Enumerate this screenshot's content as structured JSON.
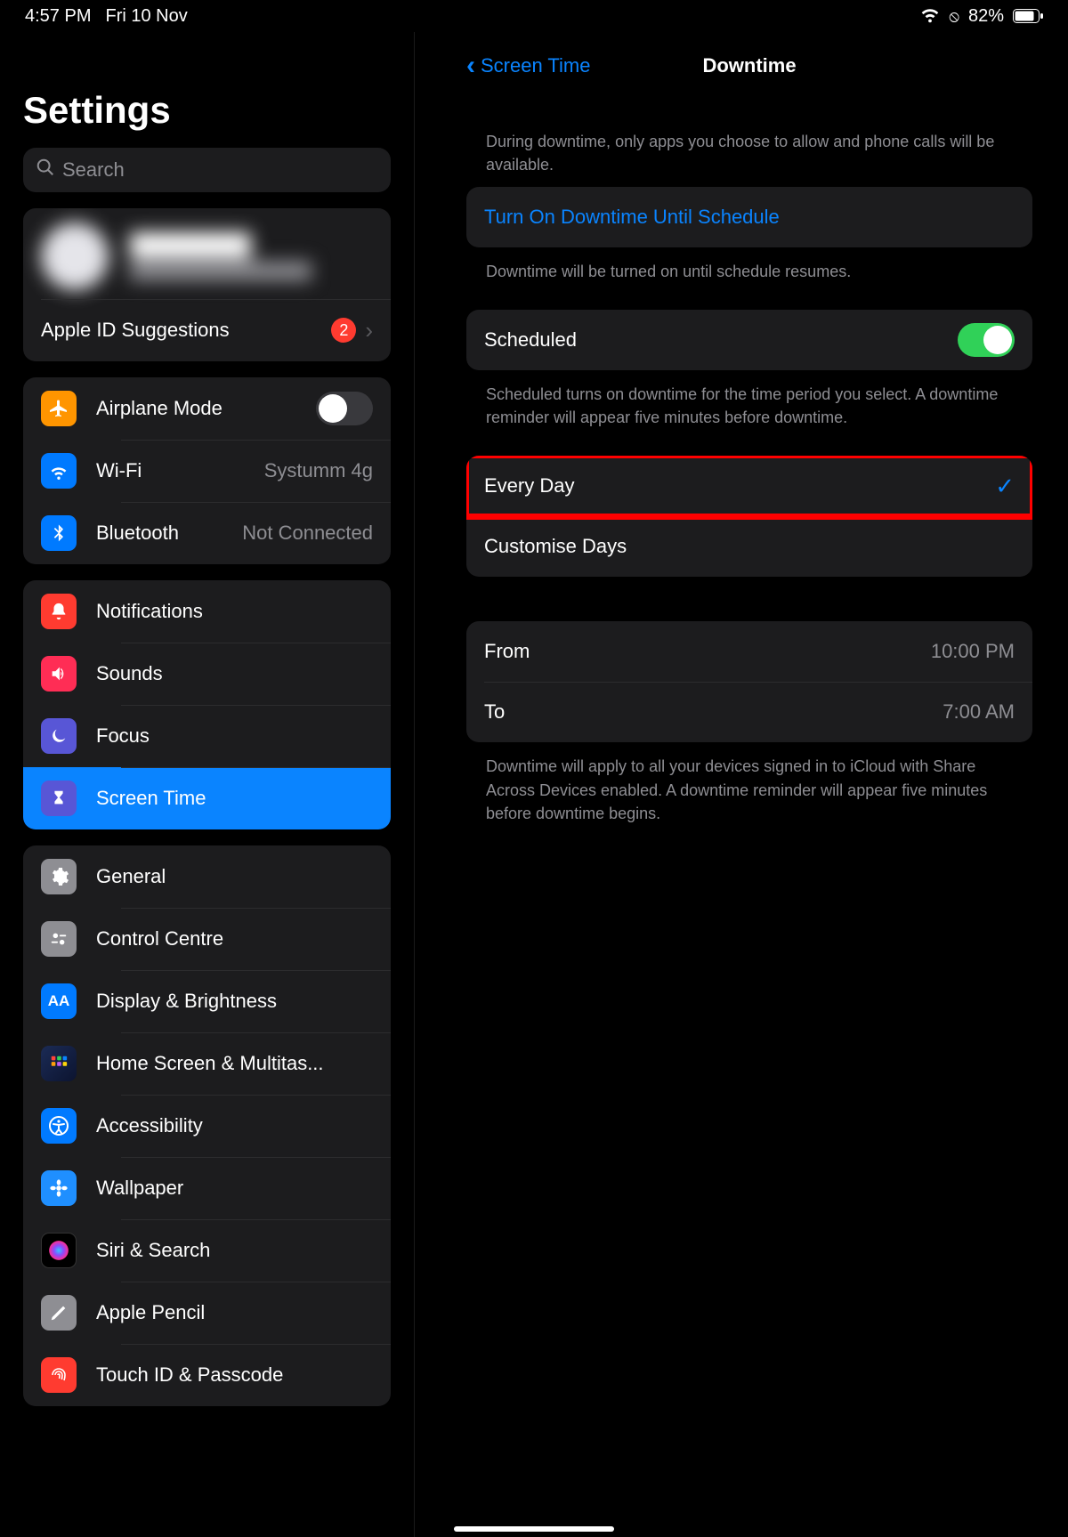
{
  "status": {
    "time": "4:57 PM",
    "date": "Fri 10 Nov",
    "battery_pct": "82%"
  },
  "left": {
    "title": "Settings",
    "search_placeholder": "Search",
    "apple_id": {
      "suggestions_label": "Apple ID Suggestions",
      "suggestions_count": "2"
    },
    "groups": [
      {
        "items": [
          {
            "label": "Airplane Mode",
            "right_type": "toggle_off",
            "icon_bg": "bg-orange",
            "icon": "airplane"
          },
          {
            "label": "Wi-Fi",
            "detail": "Systumm 4g",
            "icon_bg": "bg-blue",
            "icon": "wifi"
          },
          {
            "label": "Bluetooth",
            "detail": "Not Connected",
            "icon_bg": "bg-blue",
            "icon": "bt"
          }
        ]
      },
      {
        "items": [
          {
            "label": "Notifications",
            "icon_bg": "bg-red",
            "icon": "bell"
          },
          {
            "label": "Sounds",
            "icon_bg": "bg-pink",
            "icon": "speaker"
          },
          {
            "label": "Focus",
            "icon_bg": "bg-indigo",
            "icon": "moon"
          },
          {
            "label": "Screen Time",
            "icon_bg": "bg-indigo",
            "icon": "hourglass",
            "selected": true
          }
        ]
      },
      {
        "items": [
          {
            "label": "General",
            "icon_bg": "bg-gray",
            "icon": "gear"
          },
          {
            "label": "Control Centre",
            "icon_bg": "bg-gray",
            "icon": "sliders"
          },
          {
            "label": "Display & Brightness",
            "icon_bg": "bg-blue",
            "icon": "aa"
          },
          {
            "label": "Home Screen & Multitas...",
            "icon_bg": "bg-multicolor",
            "icon": "grid"
          },
          {
            "label": "Accessibility",
            "icon_bg": "bg-blue",
            "icon": "person"
          },
          {
            "label": "Wallpaper",
            "icon_bg": "bg-cyan",
            "icon": "flower"
          },
          {
            "label": "Siri & Search",
            "icon_bg": "bg-dark",
            "icon": "siri"
          },
          {
            "label": "Apple Pencil",
            "icon_bg": "bg-gray",
            "icon": "pencil"
          },
          {
            "label": "Touch ID & Passcode",
            "icon_bg": "bg-red",
            "icon": "finger"
          }
        ]
      }
    ]
  },
  "right": {
    "back_label": "Screen Time",
    "title": "Downtime",
    "intro": "During downtime, only apps you choose to allow and phone calls will be available.",
    "turn_on_label": "Turn On Downtime Until Schedule",
    "turn_on_footer": "Downtime will be turned on until schedule resumes.",
    "scheduled_label": "Scheduled",
    "scheduled_footer": "Scheduled turns on downtime for the time period you select. A downtime reminder will appear five minutes before downtime.",
    "every_day_label": "Every Day",
    "customise_label": "Customise Days",
    "from_label": "From",
    "from_value": "10:00 PM",
    "to_label": "To",
    "to_value": "7:00 AM",
    "bottom_footer": "Downtime will apply to all your devices signed in to iCloud with Share Across Devices enabled. A downtime reminder will appear five minutes before downtime begins."
  }
}
